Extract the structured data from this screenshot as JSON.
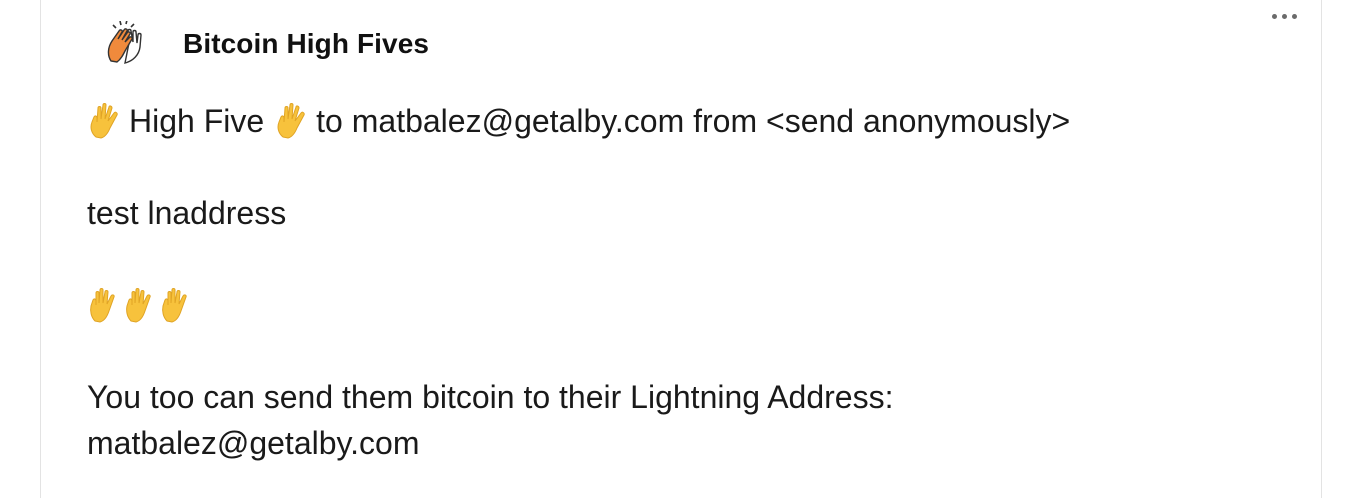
{
  "app": {
    "name": "Bitcoin High Fives",
    "avatar_icon": "clapping-high-five-icon"
  },
  "menu": {
    "more_icon": "ellipsis-icon"
  },
  "message": {
    "line1_a": "High Five",
    "line1_b": "to matbalez@getalby.com from <send anonymously>",
    "line2": "test lnaddress",
    "line4_a": "You too can send them bitcoin to their Lightning Address:",
    "line4_b": "matbalez@getalby.com"
  },
  "colors": {
    "hand": "#f7c23c",
    "hand_shadow": "#e0a425",
    "avatar": "#f08a3c"
  }
}
